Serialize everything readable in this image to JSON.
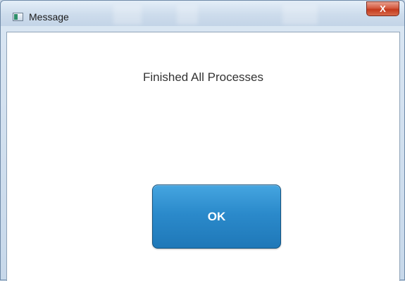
{
  "window": {
    "title": "Message",
    "close_label": "X"
  },
  "dialog": {
    "message": "Finished All Processes",
    "ok_label": "OK"
  },
  "colors": {
    "ok_button": "#2b8acb",
    "close_button": "#c3391c",
    "titlebar": "#cddcec"
  }
}
